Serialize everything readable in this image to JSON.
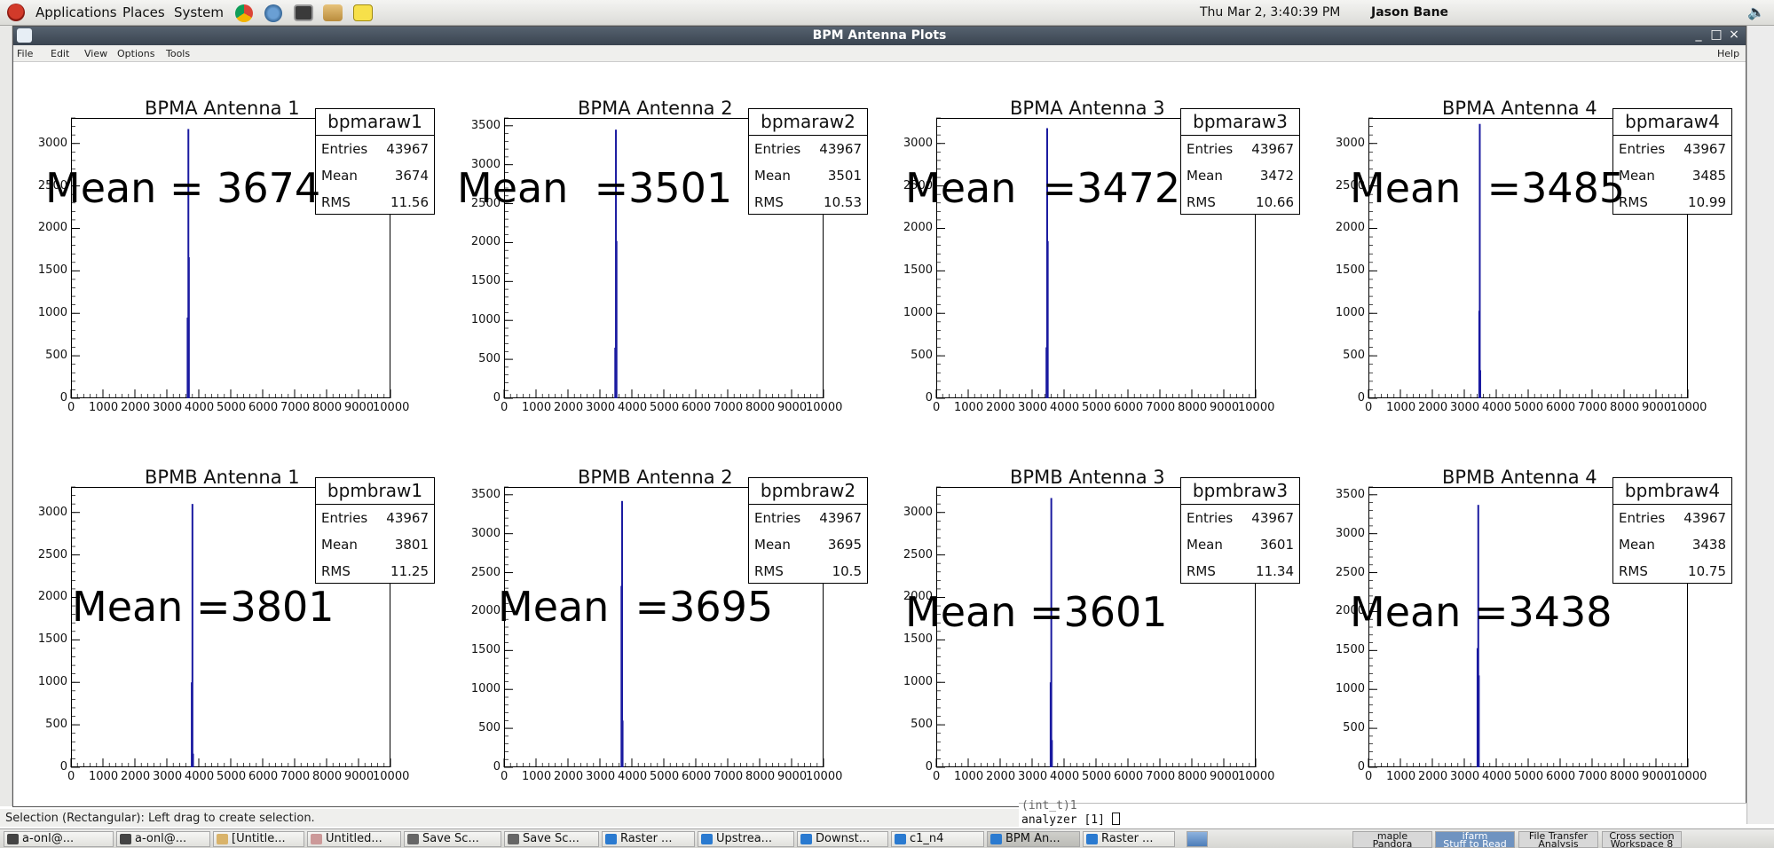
{
  "top_panel": {
    "menus": [
      "Applications",
      "Places",
      "System"
    ],
    "clock": "Thu Mar  2,  3:40:39 PM",
    "user": "Jason Bane"
  },
  "window": {
    "title": "BPM Antenna Plots",
    "menu": [
      "File",
      "Edit",
      "View",
      "Options",
      "Tools"
    ],
    "help": "Help",
    "buttons": [
      "_",
      "□",
      "×"
    ]
  },
  "chart_data": [
    {
      "type": "bar",
      "title": "BPMA Antenna 1",
      "stats_name": "bpmaraw1",
      "entries": "43967",
      "mean": "3674",
      "rms": "11.56",
      "annotation": "Mean = 3674",
      "xlim": [
        0,
        10000
      ],
      "ylim": [
        0,
        3300
      ],
      "yticks": [
        0,
        500,
        1000,
        1500,
        2000,
        2500,
        3000
      ],
      "xticks": [
        "0",
        "1000",
        "2000",
        "3000",
        "4000",
        "5000",
        "6000",
        "7000",
        "8000",
        "9000",
        "10000"
      ],
      "peaks": [
        {
          "x": 3650,
          "y": 950
        },
        {
          "x": 3674,
          "y": 3170
        },
        {
          "x": 3690,
          "y": 1660
        }
      ],
      "color": "#1a1aa0"
    },
    {
      "type": "bar",
      "title": "BPMA Antenna 2",
      "stats_name": "bpmaraw2",
      "entries": "43967",
      "mean": "3501",
      "rms": "10.53",
      "annotation": "Mean  =3501",
      "xlim": [
        0,
        10000
      ],
      "ylim": [
        0,
        3600
      ],
      "yticks": [
        0,
        500,
        1000,
        1500,
        2000,
        2500,
        3000,
        3500
      ],
      "xticks": [
        "0",
        "1000",
        "2000",
        "3000",
        "4000",
        "5000",
        "6000",
        "7000",
        "8000",
        "9000",
        "10000"
      ],
      "peaks": [
        {
          "x": 3480,
          "y": 650
        },
        {
          "x": 3501,
          "y": 3450
        },
        {
          "x": 3520,
          "y": 2020
        }
      ],
      "color": "#1a1aa0"
    },
    {
      "type": "bar",
      "title": "BPMA Antenna 3",
      "stats_name": "bpmaraw3",
      "entries": "43967",
      "mean": "3472",
      "rms": "10.66",
      "annotation": "Mean  =3472",
      "xlim": [
        0,
        10000
      ],
      "ylim": [
        0,
        3300
      ],
      "yticks": [
        0,
        500,
        1000,
        1500,
        2000,
        2500,
        3000
      ],
      "xticks": [
        "0",
        "1000",
        "2000",
        "3000",
        "4000",
        "5000",
        "6000",
        "7000",
        "8000",
        "9000",
        "10000"
      ],
      "peaks": [
        {
          "x": 3450,
          "y": 600
        },
        {
          "x": 3472,
          "y": 3180
        },
        {
          "x": 3490,
          "y": 1850
        }
      ],
      "color": "#1a1aa0"
    },
    {
      "type": "bar",
      "title": "BPMA Antenna 4",
      "stats_name": "bpmaraw4",
      "entries": "43967",
      "mean": "3485",
      "rms": "10.99",
      "annotation": "Mean  =3485",
      "xlim": [
        0,
        10000
      ],
      "ylim": [
        0,
        3300
      ],
      "yticks": [
        0,
        500,
        1000,
        1500,
        2000,
        2500,
        3000
      ],
      "xticks": [
        "0",
        "1000",
        "2000",
        "3000",
        "4000",
        "5000",
        "6000",
        "7000",
        "8000",
        "9000",
        "10000"
      ],
      "peaks": [
        {
          "x": 3470,
          "y": 1030
        },
        {
          "x": 3485,
          "y": 3230
        },
        {
          "x": 3500,
          "y": 330
        }
      ],
      "color": "#1a1aa0"
    },
    {
      "type": "bar",
      "title": "BPMB Antenna 1",
      "stats_name": "bpmbraw1",
      "entries": "43967",
      "mean": "3801",
      "rms": "11.25",
      "annotation": "Mean =3801",
      "xlim": [
        0,
        10000
      ],
      "ylim": [
        0,
        3300
      ],
      "yticks": [
        0,
        500,
        1000,
        1500,
        2000,
        2500,
        3000
      ],
      "xticks": [
        "0",
        "1000",
        "2000",
        "3000",
        "4000",
        "5000",
        "6000",
        "7000",
        "8000",
        "9000",
        "10000"
      ],
      "peaks": [
        {
          "x": 3780,
          "y": 1000
        },
        {
          "x": 3801,
          "y": 3100
        },
        {
          "x": 3820,
          "y": 160
        }
      ],
      "color": "#1a1aa0"
    },
    {
      "type": "bar",
      "title": "BPMB Antenna 2",
      "stats_name": "bpmbraw2",
      "entries": "43967",
      "mean": "3695",
      "rms": "10.5",
      "annotation": "Mean  =3695",
      "xlim": [
        0,
        10000
      ],
      "ylim": [
        0,
        3600
      ],
      "yticks": [
        0,
        500,
        1000,
        1500,
        2000,
        2500,
        3000,
        3500
      ],
      "xticks": [
        "0",
        "1000",
        "2000",
        "3000",
        "4000",
        "5000",
        "6000",
        "7000",
        "8000",
        "9000",
        "10000"
      ],
      "peaks": [
        {
          "x": 3675,
          "y": 2330
        },
        {
          "x": 3695,
          "y": 3420
        },
        {
          "x": 3710,
          "y": 600
        }
      ],
      "color": "#1a1aa0"
    },
    {
      "type": "bar",
      "title": "BPMB Antenna 3",
      "stats_name": "bpmbraw3",
      "entries": "43967",
      "mean": "3601",
      "rms": "11.34",
      "annotation": "Mean =3601",
      "xlim": [
        0,
        10000
      ],
      "ylim": [
        0,
        3300
      ],
      "yticks": [
        0,
        500,
        1000,
        1500,
        2000,
        2500,
        3000
      ],
      "xticks": [
        "0",
        "1000",
        "2000",
        "3000",
        "4000",
        "5000",
        "6000",
        "7000",
        "8000",
        "9000",
        "10000"
      ],
      "peaks": [
        {
          "x": 3580,
          "y": 1000
        },
        {
          "x": 3601,
          "y": 3170
        },
        {
          "x": 3620,
          "y": 320
        }
      ],
      "color": "#1a1aa0"
    },
    {
      "type": "bar",
      "title": "BPMB Antenna 4",
      "stats_name": "bpmbraw4",
      "entries": "43967",
      "mean": "3438",
      "rms": "10.75",
      "annotation": "Mean =3438",
      "xlim": [
        0,
        10000
      ],
      "ylim": [
        0,
        3600
      ],
      "yticks": [
        0,
        500,
        1000,
        1500,
        2000,
        2500,
        3000,
        3500
      ],
      "xticks": [
        "0",
        "1000",
        "2000",
        "3000",
        "4000",
        "5000",
        "6000",
        "7000",
        "8000",
        "9000",
        "10000"
      ],
      "peaks": [
        {
          "x": 3415,
          "y": 1530
        },
        {
          "x": 3438,
          "y": 3370
        },
        {
          "x": 3455,
          "y": 1180
        }
      ],
      "color": "#1a1aa0"
    }
  ],
  "stats_labels": {
    "entries": "Entries",
    "mean": "Mean",
    "rms": "RMS"
  },
  "statusbar": "Selection (Rectangular): Left drag to create selection.",
  "terminal": {
    "line1": "(int_t)1",
    "line2": "analyzer [1] "
  },
  "taskbar": {
    "tasks": [
      "a-onl@...",
      "a-onl@...",
      "[Untitle...",
      "Untitled...",
      "Save Sc...",
      "Save Sc...",
      "Raster ...",
      "Upstrea...",
      "Downst...",
      "c1_n4",
      "BPM An...",
      "Raster ..."
    ],
    "workspaces": [
      {
        "top": "maple",
        "bottom": "Pandora"
      },
      {
        "top": "ifarm",
        "bottom": "Stuff to Read"
      },
      {
        "top": "File Transfer",
        "bottom": "Analysis"
      },
      {
        "top": "Cross section",
        "bottom": "Workspace 8"
      }
    ]
  }
}
